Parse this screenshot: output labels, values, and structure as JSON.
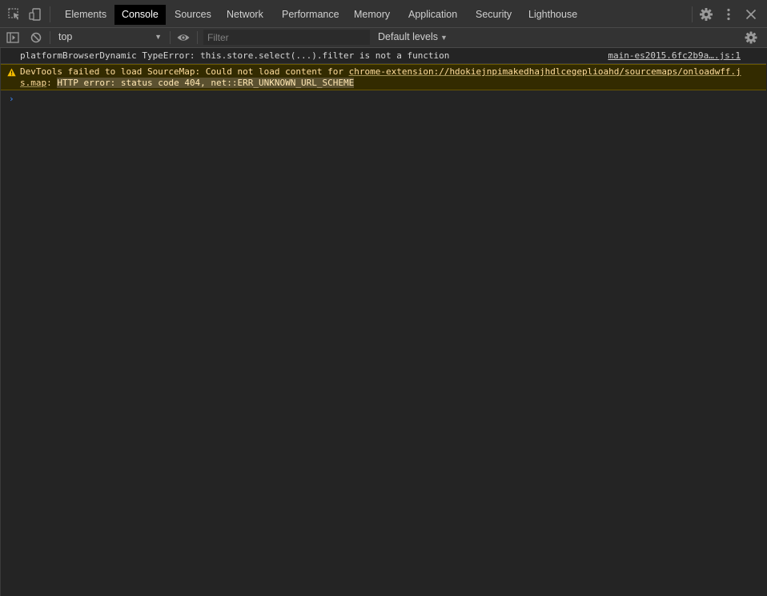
{
  "tabs": [
    {
      "label": "Elements"
    },
    {
      "label": "Console"
    },
    {
      "label": "Sources"
    },
    {
      "label": "Network"
    },
    {
      "label": "Performance"
    },
    {
      "label": "Memory"
    },
    {
      "label": "Application"
    },
    {
      "label": "Security"
    },
    {
      "label": "Lighthouse"
    }
  ],
  "active_tab": "Console",
  "toolbar": {
    "context": "top",
    "filter_placeholder": "Filter",
    "levels": "Default levels"
  },
  "messages": {
    "error": {
      "text": "platformBrowserDynamic TypeError: this.store.select(...).filter is not a function",
      "source": "main-es2015.6fc2b9a….js:1"
    },
    "warning": {
      "prefix": "DevTools failed to load SourceMap: Could not load content for ",
      "link_line1": "chrome-extension://hdokiejnpimakedhajhdlcegeplioahd/sourcemaps/onloadwff.j",
      "link_line2": "s.map",
      "sep": ": ",
      "detail": "HTTP error: status code 404, net::ERR_UNKNOWN_URL_SCHEME"
    }
  },
  "prompt_symbol": "›",
  "colors": {
    "panel_bg": "#242424",
    "toolbar_bg": "#333333",
    "warning_bg": "#332b00",
    "warning_text": "#ffdd9e",
    "prompt": "#3d8bff"
  }
}
